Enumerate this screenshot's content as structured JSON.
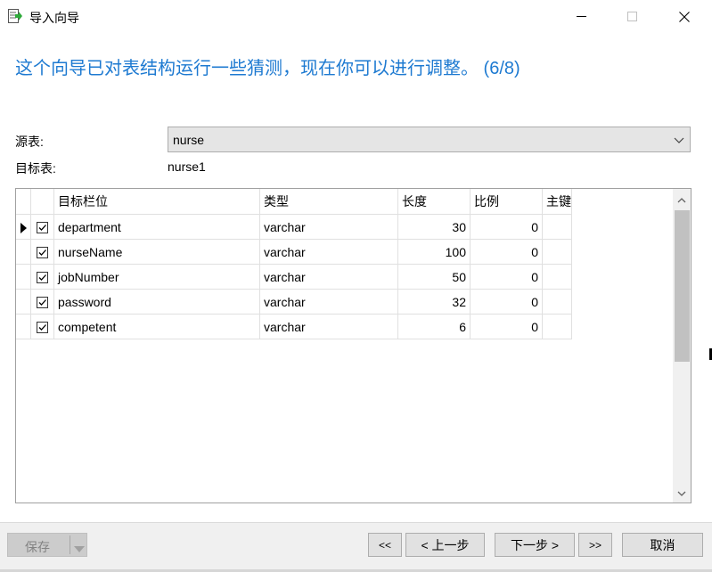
{
  "window": {
    "title": "导入向导",
    "icon": "import-wizard-icon"
  },
  "heading": "这个向导已对表结构运行一些猜测，现在你可以进行调整。 (6/8)",
  "form": {
    "source_label": "源表:",
    "source_value": "nurse",
    "target_label": "目标表:",
    "target_value": "nurse1"
  },
  "grid": {
    "columns": [
      "目标栏位",
      "类型",
      "长度",
      "比例",
      "主键"
    ],
    "rows": [
      {
        "checked": true,
        "current": true,
        "name": "department",
        "type": "varchar",
        "length": "30",
        "scale": "0"
      },
      {
        "checked": true,
        "current": false,
        "name": "nurseName",
        "type": "varchar",
        "length": "100",
        "scale": "0"
      },
      {
        "checked": true,
        "current": false,
        "name": "jobNumber",
        "type": "varchar",
        "length": "50",
        "scale": "0"
      },
      {
        "checked": true,
        "current": false,
        "name": "password",
        "type": "varchar",
        "length": "32",
        "scale": "0"
      },
      {
        "checked": true,
        "current": false,
        "name": "competent",
        "type": "varchar",
        "length": "6",
        "scale": "0"
      }
    ]
  },
  "footer": {
    "save": "保存",
    "first": "<<",
    "prev": "< 上一步",
    "next": "下一步 >",
    "last": ">>",
    "cancel": "取消"
  },
  "colors": {
    "heading": "#1e7ad1",
    "footer_bg": "#f0f0f0",
    "button_bg": "#e1e1e1"
  }
}
